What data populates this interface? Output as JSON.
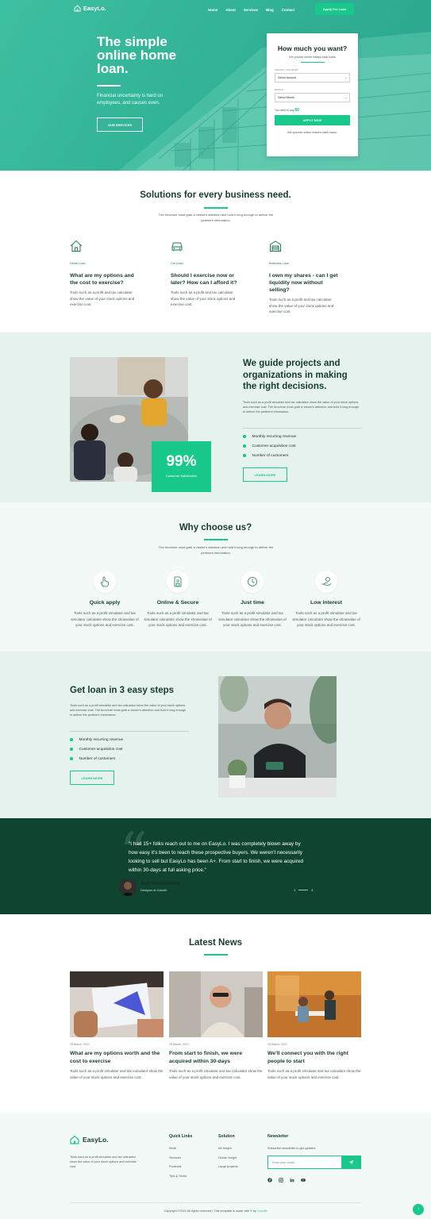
{
  "brand": {
    "name": "EasyLo.",
    "accent": "#18c98b",
    "dark": "#0f4430"
  },
  "nav": {
    "links": [
      "Home",
      "About",
      "Services",
      "Blog",
      "Contact"
    ],
    "cta": "Apply For Loan"
  },
  "hero": {
    "title": "The simple online home loan.",
    "subtitle": "Financial uncertainty is hard on employees, and causes even.",
    "button": "OUR SERVICES"
  },
  "loan_form": {
    "title": "How much you want?",
    "subtitle": "We provide online instant cash loans",
    "amount_label": "AMOUNT YOU WANT",
    "amount_value": "Select Amount",
    "month_label": "MONTH",
    "month_value": "Select Month",
    "need_label": "You need to pay",
    "need_value": "$0",
    "apply": "APPLY NOW",
    "footer": "We provide online instant cash loans."
  },
  "solutions": {
    "title": "Solutions for every business need.",
    "desc": "The brochure must grab a viewer's attention and hold it long enough to deliver the pertinent information.",
    "items": [
      {
        "icon": "house-icon",
        "category": "Home Loan",
        "title": "What are my options and the cost to exercise?",
        "text": "Tools such as a profit and tax calculator show the value of your stock options and exercise cost."
      },
      {
        "icon": "car-icon",
        "category": "Car Loan",
        "title": "Should I exercise now or later? How can I afford it?",
        "text": "Tools such as a profit and tax calculator show the value of your stock options and exercise cost."
      },
      {
        "icon": "warehouse-icon",
        "category": "Business Loan",
        "title": "I own my shares - can I get liquidity now without selling?",
        "text": "Tools such as a profit and tax calculator show the value of your stock options and exercise cost."
      }
    ]
  },
  "guide": {
    "title": "We guide projects and organizations in making the right decisions.",
    "text": "Tools such as a profit simulator and tax calculator show the value of your stock options and exercise cost. The brochure must grab a viewer's attention and hold it long enough to deliver the pertinent information.",
    "bullets": [
      "Monthly recurring revenue",
      "Customer acquisition cost",
      "Number of customers"
    ],
    "button": "LEARN MORE",
    "stat_value": "99%",
    "stat_label": "Customer Satisfaction"
  },
  "why": {
    "title": "Why choose us?",
    "desc": "The brochure must grab a viewer's attention and hold it long enough to deliver the pertinent information.",
    "items": [
      {
        "icon": "hand-pointer-icon",
        "title": "Quick apply",
        "text": "Tools such as a profit simulator and tax simulator calculator show the showvalue of your stock options and exercise cost."
      },
      {
        "icon": "document-shield-icon",
        "title": "Online & Secure",
        "text": "Tools such as a profit simulator and tax simulator calculator show the showvalue of your stock options and exercise cost."
      },
      {
        "icon": "clock-icon",
        "title": "Just time",
        "text": "Tools such as a profit simulator and tax simulator calculator show the showvalue of your stock options and exercise cost."
      },
      {
        "icon": "hand-coin-icon",
        "title": "Low interest",
        "text": "Tools such as a profit simulator and tax simulator calculator show the showvalue of your stock options and exercise cost."
      }
    ]
  },
  "steps": {
    "title": "Get loan in 3 easy steps",
    "text": "Tools such as a profit simulator and tax calculator show the value of your stock options and exercise cost. The brochure must grab a viewer's attention and hold it long enough to deliver the pertinent information.",
    "bullets": [
      "Monthly recurring revenue",
      "Customer acquisition cost",
      "Number of customers"
    ],
    "button": "LEARN MORE"
  },
  "testimonial": {
    "quote": "\"I had 15+ folks reach out to me on EasyLo. I was completely blown away by how easy it's been to reach these prospective buyers. We weren't necessarily looking to sell but EasyLo has been A+. From start to finish, we were acquired within 30-days at full asking price.\"",
    "name": "Ash Wednesday",
    "role": "Designer at Colorlib",
    "page_current": "1",
    "page_next": "2"
  },
  "news": {
    "title": "Latest News",
    "items": [
      {
        "date": "25 March, 2021",
        "title": "What are my options worth and the cost to exercise",
        "text": "Tools such as a profit simulator and tax calculator show the value of your stock options and exercise cost."
      },
      {
        "date": "25 March, 2021",
        "title": "From start to finish, we were acquired within 30-days",
        "text": "Tools such as a profit simulator and tax calculator show the value of your stock options and exercise cost."
      },
      {
        "date": "25 March, 2021",
        "title": "We'll connect you with the right people to start",
        "text": "Tools such as a profit simulator and tax calculator show the value of your stock options and exercise cost."
      }
    ]
  },
  "footer": {
    "about": "Tools such as a profit simulator and tax calculator show the value of your stock options and exercise cost.",
    "quick_links_title": "Quick Links",
    "quick_links": [
      "Work",
      "Services",
      "Products",
      "Tips & Tricks"
    ],
    "solution_title": "Solution",
    "solution_links": [
      "Air freight",
      "Ocean freight",
      "Large projects"
    ],
    "newsletter_title": "Newsletter",
    "newsletter_text": "Subscribe newsletter to get updates",
    "newsletter_placeholder": "Enter your email",
    "copyright": "Copyright ©2021 All rights reserved | This template is made with",
    "copyright_by": "by",
    "copyright_brand": "Colorlib"
  }
}
